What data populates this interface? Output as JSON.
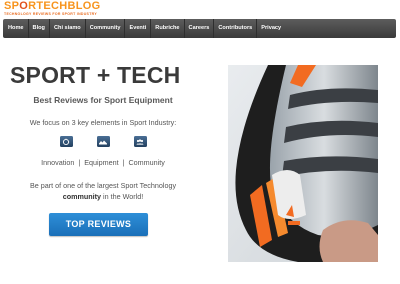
{
  "header": {
    "logo_part1": "SP",
    "logo_o": "O",
    "logo_part2": "RTECHBLOG",
    "tagline": "TECHNOLOGY REVIEWS FOR SPORT INDUSTRY"
  },
  "nav": {
    "items": [
      {
        "label": "Home"
      },
      {
        "label": "Blog"
      },
      {
        "label": "Chi siamo"
      },
      {
        "label": "Community"
      },
      {
        "label": "Eventi"
      },
      {
        "label": "Rubriche"
      },
      {
        "label": "Careers"
      },
      {
        "label": "Contributors"
      },
      {
        "label": "Privacy"
      }
    ]
  },
  "hero": {
    "title": "SPORT + TECH",
    "subtitle": "Best Reviews for Sport Equipment",
    "focus_text": "We focus on 3 key elements in Sport Industry:",
    "elements": [
      "Innovation",
      "Equipment",
      "Community"
    ],
    "separator": "|",
    "cta_line1": "Be part of one of the largest Sport Technology",
    "cta_bold": "community",
    "cta_line2_rest": " in the World!",
    "button_label": "TOP REVIEWS",
    "icons": [
      "innovation-icon",
      "equipment-icon",
      "community-icon"
    ]
  },
  "colors": {
    "logo_orange": "#f7941d",
    "nav_bg": "#4a4a4a",
    "title": "#3a3a3a",
    "button_blue": "#1f7fcc",
    "shoe_accent": "#f26b21"
  }
}
